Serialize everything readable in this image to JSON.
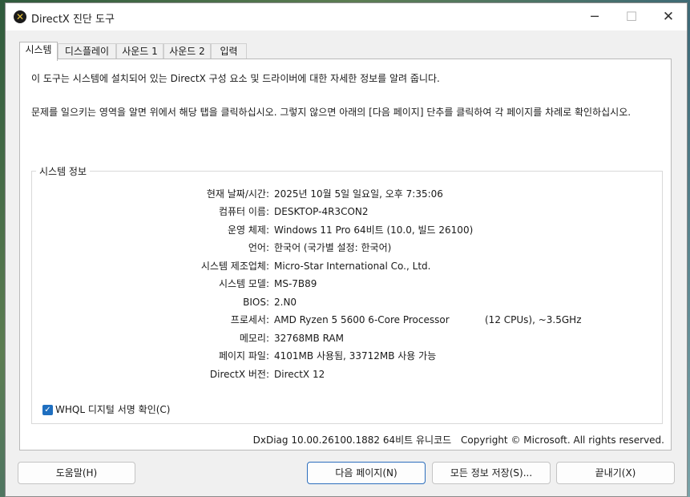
{
  "window": {
    "title": "DirectX 진단 도구",
    "icon": "directx-icon",
    "controls": {
      "minimize": "─",
      "maximize": "☐",
      "close": "✕"
    }
  },
  "tabs": [
    {
      "label": "시스템",
      "active": true
    },
    {
      "label": "디스플레이",
      "active": false
    },
    {
      "label": "사운드 1",
      "active": false
    },
    {
      "label": "사운드 2",
      "active": false
    },
    {
      "label": "입력",
      "active": false
    }
  ],
  "intro": {
    "line1": "이 도구는 시스템에 설치되어 있는 DirectX 구성 요소 및 드라이버에 대한 자세한 정보를 알려 줍니다.",
    "line2": "문제를 일으키는 영역을 알면 위에서 해당 탭을 클릭하십시오. 그렇지 않으면 아래의 [다음 페이지] 단추를 클릭하여 각 페이지를 차례로 확인하십시오."
  },
  "system_info": {
    "group_title": "시스템 정보",
    "rows": [
      {
        "label": "현재 날짜/시간:",
        "value": "2025년 10월 5일 일요일, 오후 7:35:06"
      },
      {
        "label": "컴퓨터 이름:",
        "value": "DESKTOP-4R3CON2"
      },
      {
        "label": "운영 체제:",
        "value": "Windows 11 Pro 64비트 (10.0, 빌드 26100)"
      },
      {
        "label": "언어:",
        "value": "한국어 (국가별 설정: 한국어)"
      },
      {
        "label": "시스템 제조업체:",
        "value": "Micro-Star International Co., Ltd."
      },
      {
        "label": "시스템 모델:",
        "value": "MS-7B89"
      },
      {
        "label": "BIOS:",
        "value": "2.N0"
      },
      {
        "label": "프로세서:",
        "value": "AMD Ryzen 5 5600 6-Core Processor",
        "extra": "(12 CPUs), ~3.5GHz"
      },
      {
        "label": "메모리:",
        "value": "32768MB RAM"
      },
      {
        "label": "페이지 파일:",
        "value": "4101MB 사용됨, 33712MB 사용 가능"
      },
      {
        "label": "DirectX 버전:",
        "value": "DirectX 12"
      }
    ],
    "whql": {
      "label": "WHQL 디지털 서명 확인(C)",
      "checked": true,
      "check_glyph": "✓"
    }
  },
  "footer": {
    "version": "DxDiag 10.00.26100.1882 64비트 유니코드",
    "copyright": "Copyright © Microsoft. All rights reserved."
  },
  "buttons": {
    "help": "도움말(H)",
    "next_page": "다음 페이지(N)",
    "save_all": "모든 정보 저장(S)...",
    "exit": "끝내기(X)"
  },
  "colors": {
    "accent": "#1f6fc0",
    "window_bg": "#f0f0f0",
    "panel_bg": "#ffffff"
  }
}
